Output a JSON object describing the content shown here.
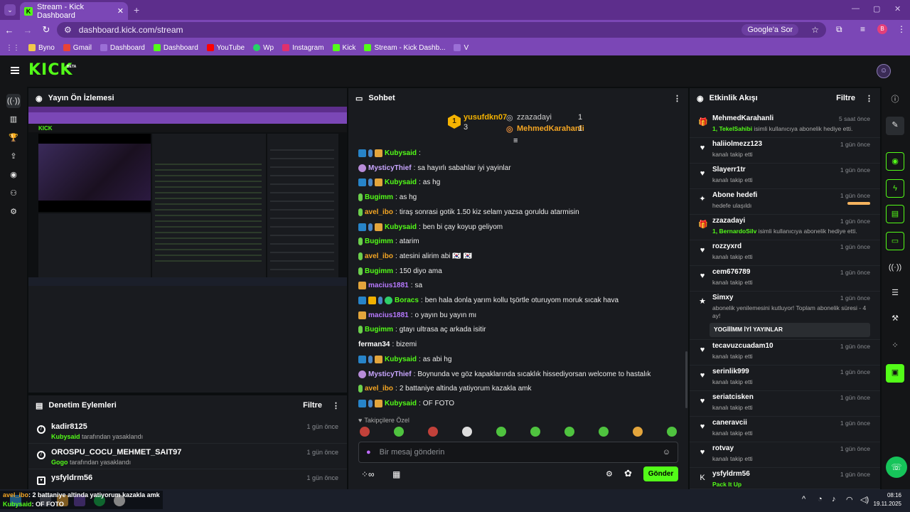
{
  "browser": {
    "tab_title": "Stream - Kick Dashboard",
    "url": "dashboard.kick.com/stream",
    "google_chip": "Google'a Sor",
    "profile_initial": "B",
    "bookmarks": [
      "Byno",
      "Gmail",
      "Dashboard",
      "Dashboard",
      "YouTube",
      "Wp",
      "Instagram",
      "Kick",
      "Stream - Kick Dashb...",
      "V"
    ]
  },
  "kick": {
    "logo": "KICK",
    "beta": "BETA"
  },
  "preview": {
    "title": "Yayın Ön İzlemesi"
  },
  "mod": {
    "title": "Denetim Eylemleri",
    "filter": "Filtre",
    "rows": [
      {
        "user": "kadir8125",
        "by": "Kubysaid",
        "action": "tarafından yasaklandı",
        "time": "1 gün önce"
      },
      {
        "user": "OROSPU_COCU_MEHMET_SAIT97",
        "by": "Gogo",
        "action": "tarafından yasaklandı",
        "time": "1 gün önce"
      },
      {
        "user": "ysfyldrm56",
        "by": "",
        "action": "",
        "time": "1 gün önce"
      }
    ]
  },
  "chat": {
    "title": "Sohbet",
    "pinned": [
      {
        "name": "yusufdkn07",
        "count": "3",
        "rank": "1"
      },
      {
        "name": "zzazadayi",
        "count": "1"
      },
      {
        "name": "MehmedKarahanli",
        "count": "1"
      }
    ],
    "messages": [
      {
        "name": "Kubysaid",
        "color": "#53fc18",
        "text": ""
      },
      {
        "name": "MysticyThief",
        "color": "#c9a6ff",
        "text": "sa hayırlı sabahlar iyi yayinlar"
      },
      {
        "name": "Kubysaid",
        "color": "#53fc18",
        "text": "as hg"
      },
      {
        "name": "Bugimm",
        "color": "#53fc18",
        "text": "as hg"
      },
      {
        "name": "avel_ibo",
        "color": "#f5a623",
        "text": "tiraş sonrasi gotik 1.50 kiz selam yazsa goruldu atarmisin"
      },
      {
        "name": "Kubysaid",
        "color": "#53fc18",
        "text": "ben bi çay koyup geliyom"
      },
      {
        "name": "Bugimm",
        "color": "#53fc18",
        "text": "atarim"
      },
      {
        "name": "avel_ibo",
        "color": "#f5a623",
        "text": "atesini alirim abi 🇰🇷 🇰🇷"
      },
      {
        "name": "Bugimm",
        "color": "#53fc18",
        "text": "150 diyo ama"
      },
      {
        "name": "macius1881",
        "color": "#b779ff",
        "text": "sa"
      },
      {
        "name": "Boracs",
        "color": "#53fc18",
        "text": "ben hala donla yarım kollu tşörtle oturuyom moruk sıcak hava"
      },
      {
        "name": "macius1881",
        "color": "#b779ff",
        "text": "o yayın bu yayın mı"
      },
      {
        "name": "Bugimm",
        "color": "#53fc18",
        "text": "gtayı ultrasa aç arkada isitir"
      },
      {
        "name": "ferman34",
        "color": "#ffffff",
        "text": "bizemi"
      },
      {
        "name": "Kubysaid",
        "color": "#53fc18",
        "text": "as abi hg"
      },
      {
        "name": "MysticyThief",
        "color": "#c9a6ff",
        "text": "Boynunda ve göz kapaklarında sıcaklık hissediyorsan welcome to hastalık"
      },
      {
        "name": "avel_ibo",
        "color": "#f5a623",
        "text": "2 battaniye altinda yatiyorum kazakla amk"
      },
      {
        "name": "Kubysaid",
        "color": "#53fc18",
        "text": "OF FOTO"
      }
    ],
    "emote_label": "Takipçilere Özel",
    "input_placeholder": "Bir mesaj gönderin",
    "send": "Gönder"
  },
  "events": {
    "title": "Etkinlik Akışı",
    "filter": "Filtre",
    "rows": [
      {
        "icon": "gift",
        "user": "MehmedKarahanli",
        "detail_b": "1, TekelSahibi",
        "detail": " isimli kullanıcıya abonelik hediye etti.",
        "time": "5 saat önce"
      },
      {
        "icon": "heart",
        "user": "haliiolmezz123",
        "detail": "kanalı takip etti",
        "time": "1 gün önce"
      },
      {
        "icon": "heart",
        "user": "Slayerr1tr",
        "detail": "kanalı takip etti",
        "time": "1 gün önce"
      },
      {
        "icon": "star",
        "user": "Abone hedefi",
        "detail": "hedefe ulaşıldı",
        "time": "1 gün önce"
      },
      {
        "icon": "gift",
        "user": "zzazadayi",
        "detail_b": "1, BernardoSilv",
        "detail": " isimli kullanıcıya abonelik hediye etti.",
        "time": "1 gün önce"
      },
      {
        "icon": "heart",
        "user": "rozzyxrd",
        "detail": "kanalı takip etti",
        "time": "1 gün önce"
      },
      {
        "icon": "heart",
        "user": "cem676789",
        "detail": "kanalı takip etti",
        "time": "1 gün önce"
      },
      {
        "icon": "sub",
        "user": "Simxy",
        "detail": "abonelik yenilemesini kutluyor! Toplam abonelik süresi - 4 ay!",
        "msg": "YOGİİİMM İYİ YAYINLAR",
        "time": "1 gün önce"
      },
      {
        "icon": "heart",
        "user": "tecavuzcuadam10",
        "detail": "kanalı takip etti",
        "time": "1 gün önce"
      },
      {
        "icon": "heart",
        "user": "serinlik999",
        "detail": "kanalı takip etti",
        "time": "1 gün önce"
      },
      {
        "icon": "heart",
        "user": "seriatcisken",
        "detail": "kanalı takip etti",
        "time": "1 gün önce"
      },
      {
        "icon": "heart",
        "user": "caneravcii",
        "detail": "kanalı takip etti",
        "time": "1 gün önce"
      },
      {
        "icon": "heart",
        "user": "rotvay",
        "detail": "kanalı takip etti",
        "time": "1 gün önce"
      },
      {
        "icon": "kick",
        "user": "ysfyldrm56",
        "detail_b": "Pack It Up",
        "detail": "",
        "time": "1 gün önce"
      }
    ]
  },
  "overlay": [
    {
      "name": "avel_ibo",
      "text": ": 2 battaniye altinda yatiyorum kazakla amk"
    },
    {
      "name": "Kubysaid",
      "text": ": OF FOTO"
    }
  ],
  "taskbar": {
    "time": "08:16",
    "date": "19.11.2025"
  },
  "colors": {
    "accent": "#53fc18",
    "browser": "#7b47b6",
    "panel": "#191b1f"
  }
}
